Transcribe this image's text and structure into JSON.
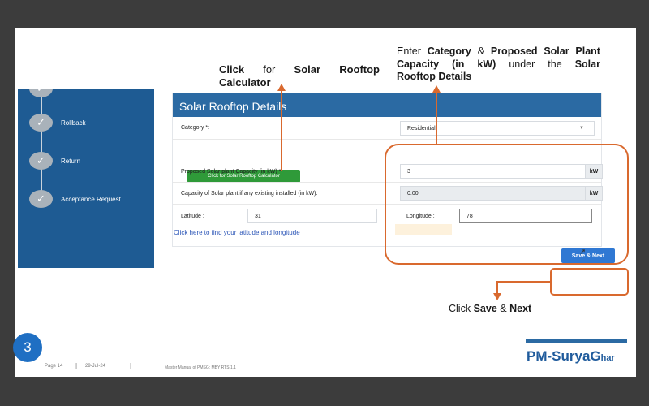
{
  "sidebar": {
    "steps": [
      {
        "label": "Rollback"
      },
      {
        "label": "Return"
      },
      {
        "label": "Acceptance Request"
      }
    ],
    "check_glyph": "✓"
  },
  "panel": {
    "title": "Solar Rooftop Details",
    "category_label": "Category *:",
    "category_value": "Residential",
    "calc_button": "Click for Solar Rooftop Calculator",
    "capacity_label": "Proposed Solar plant Capacity (in kW) *:",
    "capacity_value": "3",
    "capacity_unit": "kW",
    "existing_label": "Capacity of Solar plant if any existing installed (in kW):",
    "existing_value": "0.00",
    "existing_unit": "kW",
    "latitude_label": "Latitude :",
    "latitude_value": "31",
    "longitude_label": "Longitude :",
    "longitude_value": "78",
    "find_link": "Click here to find your latitude and longitude",
    "save_button": "Save & Next"
  },
  "annotations": {
    "calc": {
      "w1": "Click",
      "w2": "for",
      "w3": "Solar",
      "w4": "Rooftop",
      "w5": "Calculator"
    },
    "category": {
      "line1": [
        "Enter",
        "Category",
        "&",
        "Proposed",
        "Solar",
        "Plant"
      ],
      "line2": [
        "Capacity",
        "(in",
        "kW)",
        "under",
        "the",
        "Solar"
      ],
      "line3": "Rooftop Details"
    },
    "save": {
      "pre": "Click",
      "b1": "Save",
      "amp": "&",
      "b2": "Next"
    }
  },
  "footer": {
    "page": "Page 14",
    "date": "29-Jul-24",
    "manual": "Master Manual of PMSG: MBY RTS 1.1",
    "slide_number": "3",
    "brand_main": "PM-SuryaG",
    "brand_small": "har"
  },
  "colors": {
    "annotation_orange": "#d9692e",
    "sidebar_blue": "#1e5b93",
    "header_blue": "#2b6aa3",
    "button_green": "#2f9a39",
    "button_blue": "#2f78d3"
  }
}
